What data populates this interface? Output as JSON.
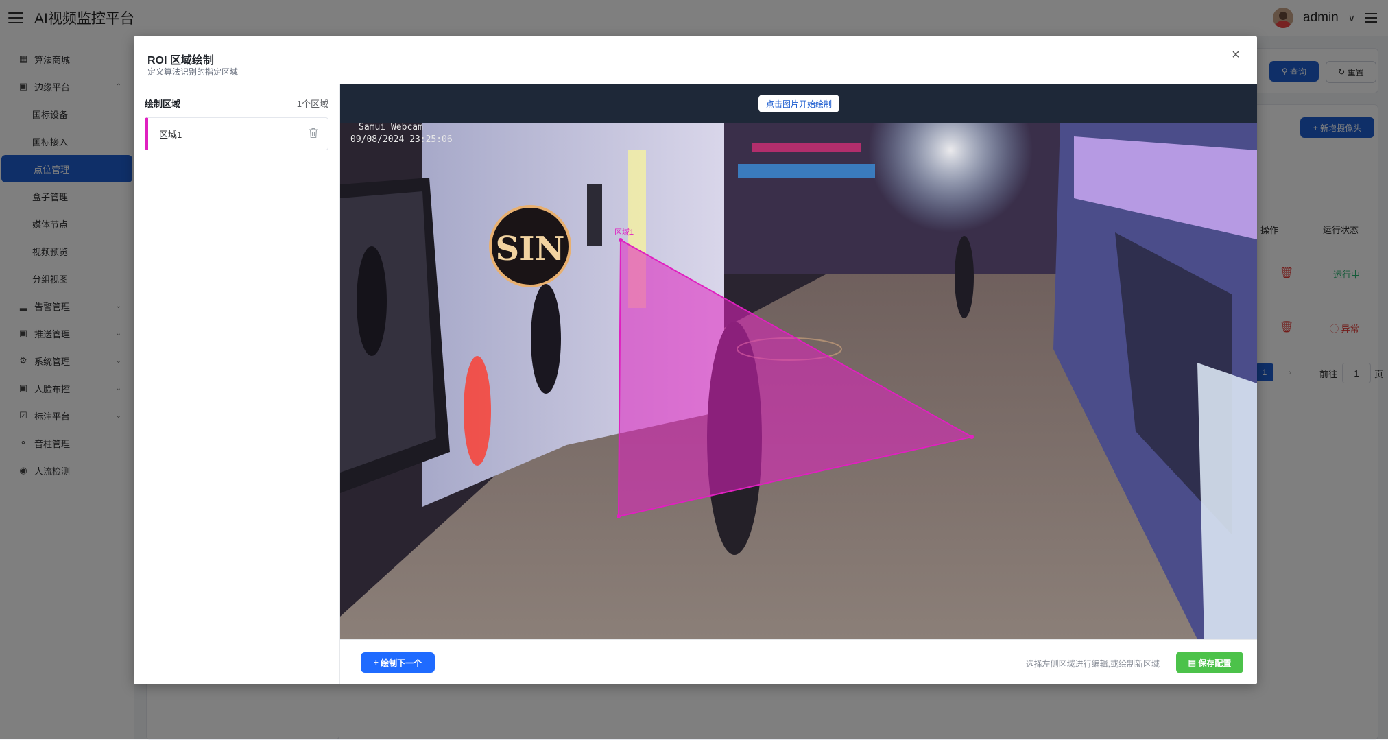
{
  "app": {
    "title": "AI视频监控平台",
    "user": "admin"
  },
  "sidebar": {
    "items": [
      {
        "label": "算法商城",
        "icon": "grid-icon"
      },
      {
        "label": "边缘平台",
        "icon": "briefcase-icon"
      },
      {
        "label": "国标设备"
      },
      {
        "label": "国标接入"
      },
      {
        "label": "点位管理"
      },
      {
        "label": "盒子管理"
      },
      {
        "label": "媒体节点"
      },
      {
        "label": "视频预览"
      },
      {
        "label": "分组视图"
      },
      {
        "label": "告警管理",
        "icon": "bar-chart-icon"
      },
      {
        "label": "推送管理",
        "icon": "message-icon"
      },
      {
        "label": "系统管理",
        "icon": "gear-icon"
      },
      {
        "label": "人脸布控",
        "icon": "briefcase-icon"
      },
      {
        "label": "标注平台",
        "icon": "clipboard-icon"
      },
      {
        "label": "音柱管理",
        "icon": "mic-icon"
      },
      {
        "label": "人流检测",
        "icon": "eye-icon"
      }
    ]
  },
  "background": {
    "query_label": "查询",
    "reset_label": "重置",
    "add_camera_label": "新增摄像头",
    "col_action": "操作",
    "col_status": "运行状态",
    "row1_status": "运行中",
    "row2_status": "异常",
    "pager_current": "1",
    "pager_goto": "前往",
    "pager_input": "1",
    "pager_unit": "页"
  },
  "modal": {
    "title": "ROI 区域绘制",
    "subtitle": "定义算法识别的指定区域",
    "panel_title": "绘制区域",
    "region_count": "1个区域",
    "regions": [
      {
        "name": "区域1",
        "color": "#e020c0"
      }
    ],
    "draw_hint_button": "点击图片开始绘制",
    "camera_name": "Samui Webcam",
    "camera_time": "09/08/2024 23:25:06",
    "roi_label": "区域1",
    "draw_next_label": "绘制下一个",
    "footer_hint": "选择左侧区域进行编辑,或绘制新区域",
    "save_label": "保存配置"
  },
  "colors": {
    "primary": "#1f5fd0",
    "roi": "#e020c0",
    "save": "#4cc24a",
    "running": "#2bb673",
    "error": "#e53935"
  }
}
